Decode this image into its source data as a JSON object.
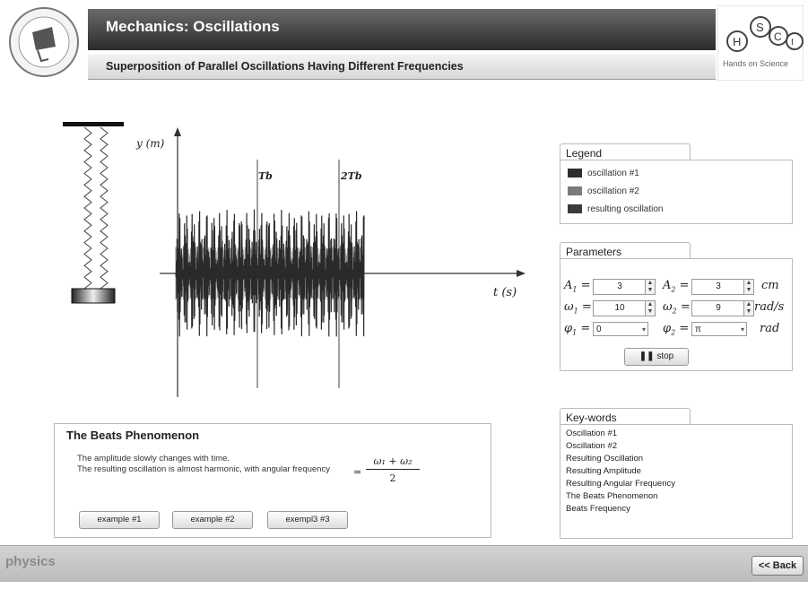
{
  "header": {
    "title": "Mechanics: Oscillations",
    "subtitle": "Superposition of Parallel Oscillations Having Different Frequencies",
    "logo_right_text": "Hands on Science"
  },
  "simulation": {
    "y_axis_label": "y (m)",
    "x_axis_label": "t (s)",
    "marker_1": "Tb",
    "marker_2": "2Tb"
  },
  "legend": {
    "title": "Legend",
    "items": [
      {
        "label": "oscillation #1",
        "color": "#2e2e2e"
      },
      {
        "label": "oscillation #2",
        "color": "#7a7a7a"
      },
      {
        "label": "resulting oscillation",
        "color": "#3a3a3a"
      }
    ]
  },
  "parameters": {
    "title": "Parameters",
    "A1": {
      "label": "A",
      "sub": "1",
      "value": "3"
    },
    "A2": {
      "label": "A",
      "sub": "2",
      "value": "3"
    },
    "A_unit": "cm",
    "w1": {
      "label": "ω",
      "sub": "1",
      "value": "10"
    },
    "w2": {
      "label": "ω",
      "sub": "2",
      "value": "9"
    },
    "w_unit": "rad/s",
    "phi1": {
      "label": "φ",
      "sub": "1",
      "value": "0"
    },
    "phi2": {
      "label": "φ",
      "sub": "2",
      "value": "π"
    },
    "phi_unit": "rad",
    "stop_label": "stop"
  },
  "beats": {
    "title": "The Beats Phenomenon",
    "line1": "The amplitude slowly changes with time.",
    "line2": "The resulting oscillation is almost harmonic, with angular frequency",
    "formula_num": "ω₁ + ω₂",
    "formula_den": "2",
    "buttons": [
      "example #1",
      "example #2",
      "exempl3 #3"
    ]
  },
  "keywords": {
    "title": "Key-words",
    "items": [
      "Oscillation #1",
      "Oscillation #2",
      "Resulting Oscillation",
      "Resulting Amplitude",
      "Resulting Angular Frequency",
      "The Beats Phenomenon",
      "Beats Frequency"
    ]
  },
  "footer": {
    "brand": "physics",
    "back_label": "<< Back"
  }
}
